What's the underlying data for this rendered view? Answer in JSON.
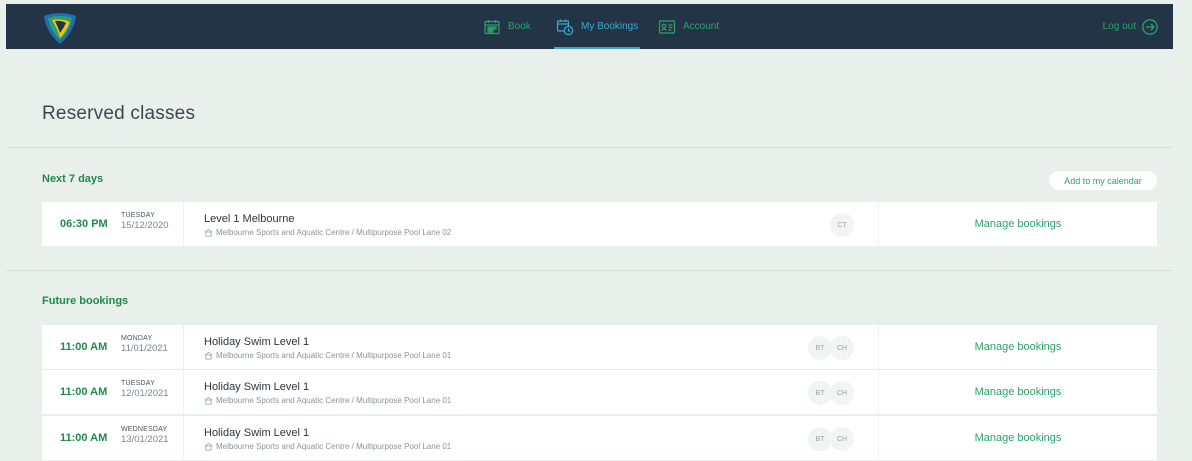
{
  "nav": {
    "items": [
      {
        "label": "Book",
        "icon": "calendar-icon"
      },
      {
        "label": "My Bookings",
        "icon": "calendar-clock-icon",
        "active": true
      },
      {
        "label": "Account",
        "icon": "id-card-icon"
      }
    ],
    "logout_label": "Log out"
  },
  "page": {
    "title": "Reserved classes"
  },
  "sections": {
    "next7": {
      "title": "Next 7 days",
      "calendar_button": "Add to my calendar",
      "rows": [
        {
          "time": "06:30 PM",
          "day": "TUESDAY",
          "date": "15/12/2020",
          "name": "Level 1 Melbourne",
          "location": "Melbourne Sports and Aquatic Centre / Multipurpose Pool Lane 02",
          "avatars": [
            "CT"
          ],
          "action": "Manage bookings"
        }
      ]
    },
    "future": {
      "title": "Future bookings",
      "rows": [
        {
          "time": "11:00 AM",
          "day": "MONDAY",
          "date": "11/01/2021",
          "name": "Holiday Swim Level 1",
          "location": "Melbourne Sports and Aquatic Centre / Multipurpose Pool Lane 01",
          "avatars": [
            "BT",
            "CH"
          ],
          "action": "Manage bookings"
        },
        {
          "time": "11:00 AM",
          "day": "TUESDAY",
          "date": "12/01/2021",
          "name": "Holiday Swim Level 1",
          "location": "Melbourne Sports and Aquatic Centre / Multipurpose Pool Lane 01",
          "avatars": [
            "BT",
            "CH"
          ],
          "action": "Manage bookings"
        },
        {
          "time": "11:00 AM",
          "day": "WEDNESDAY",
          "date": "13/01/2021",
          "name": "Holiday Swim Level 1",
          "location": "Melbourne Sports and Aquatic Centre / Multipurpose Pool Lane 01",
          "avatars": [
            "BT",
            "CH"
          ],
          "action": "Manage bookings"
        }
      ]
    }
  },
  "colors": {
    "nav_bg": "#233446",
    "accent_green": "#2aa36a",
    "accent_blue": "#3aa8d0",
    "page_bg": "#e9efeb"
  }
}
